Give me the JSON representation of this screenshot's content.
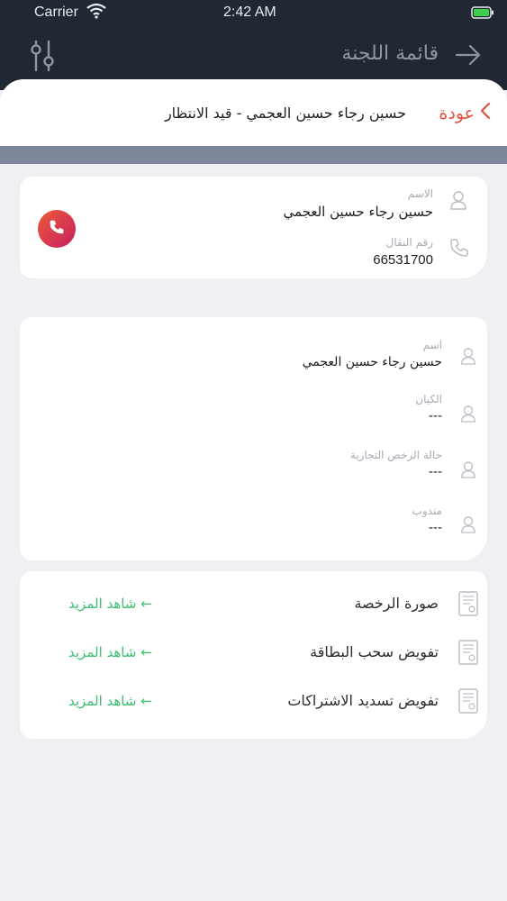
{
  "status_bar": {
    "carrier": "Carrier",
    "time": "2:42 AM"
  },
  "nav": {
    "title": "قائمة اللجنة"
  },
  "header": {
    "back_label": "عودة",
    "title": "حسين رجاء حسين العجمي - قيد الانتظار"
  },
  "contact": {
    "name_label": "الاسم",
    "name_value": "حسين رجاء حسين العجمي",
    "phone_label": "رقم النقال",
    "phone_value": "66531700"
  },
  "details": [
    {
      "label": "اسم",
      "value": "حسين رجاء حسين العجمي"
    },
    {
      "label": "الكيان",
      "value": "---"
    },
    {
      "label": "حالة الرخص التجارية",
      "value": "---"
    },
    {
      "label": "مندوب",
      "value": "---"
    }
  ],
  "documents": [
    {
      "name": "صورة الرخصة",
      "more": "شاهد المزيد ←"
    },
    {
      "name": "تفويض سحب البطاقة",
      "more": "شاهد المزيد ←"
    },
    {
      "name": "تفويض تسديد الاشتراكات",
      "more": "شاهد المزيد ←"
    }
  ],
  "colors": {
    "top_bar": "#202833",
    "accent_red": "#e2533e",
    "link_green": "#3cbf73",
    "band": "#7d889b",
    "page_bg": "#eef0f4"
  },
  "icons": [
    "wifi-icon",
    "battery-icon",
    "filter-icon",
    "arrow-right-icon",
    "chevron-left-icon",
    "person-icon",
    "phone-icon",
    "document-icon"
  ]
}
